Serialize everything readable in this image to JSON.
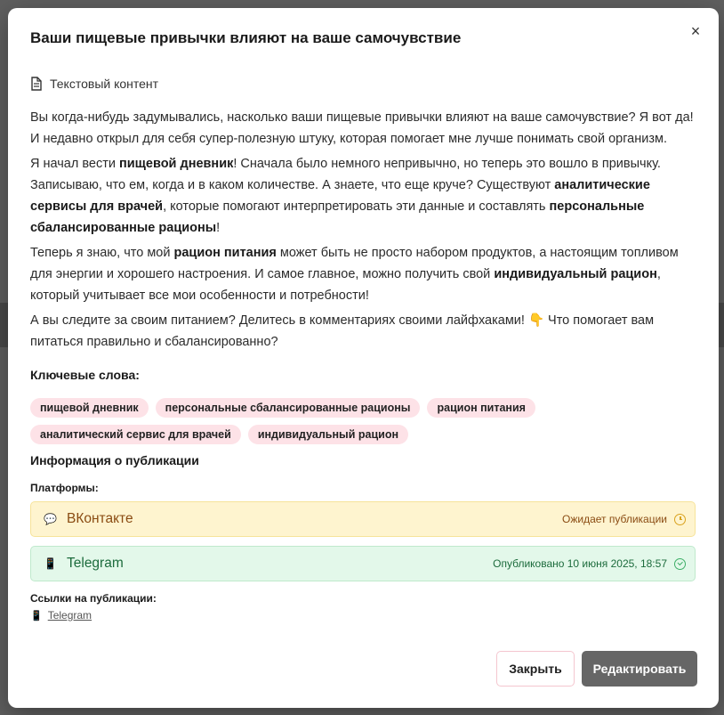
{
  "modal": {
    "title": "Ваши пищевые привычки влияют на ваше самочувствие",
    "content_type_label": "Текстовый контент",
    "paragraphs": [
      [
        {
          "text": "Вы когда-нибудь задумывались, насколько ваши пищевые привычки влияют на ваше самочувствие? Я вот да! И недавно открыл для себя супер-полезную штуку, которая помогает мне лучше понимать свой организм.",
          "bold": false
        }
      ],
      [
        {
          "text": "Я начал вести ",
          "bold": false
        },
        {
          "text": "пищевой дневник",
          "bold": true
        },
        {
          "text": "! Сначала было немного непривычно, но теперь это вошло в привычку. Записываю, что ем, когда и в каком количестве. А знаете, что еще круче? Существуют ",
          "bold": false
        },
        {
          "text": "аналитические сервисы для врачей",
          "bold": true
        },
        {
          "text": ", которые помогают интерпретировать эти данные и составлять ",
          "bold": false
        },
        {
          "text": "персональные сбалансированные рационы",
          "bold": true
        },
        {
          "text": "!",
          "bold": false
        }
      ],
      [
        {
          "text": "Теперь я знаю, что мой ",
          "bold": false
        },
        {
          "text": "рацион питания",
          "bold": true
        },
        {
          "text": " может быть не просто набором продуктов, а настоящим топливом для энергии и хорошего настроения. И самое главное, можно получить свой ",
          "bold": false
        },
        {
          "text": "индивидуальный рацион",
          "bold": true
        },
        {
          "text": ", который учитывает все мои особенности и потребности!",
          "bold": false
        }
      ],
      [
        {
          "text": "А вы следите за своим питанием? Делитесь в комментариях своими лайфхаками! 👇 Что помогает вам питаться правильно и сбалансированно?",
          "bold": false
        }
      ]
    ],
    "keywords_heading": "Ключевые слова:",
    "keywords_rows": [
      [
        "пищевой дневник",
        "персональные сбалансированные рационы",
        "рацион питания"
      ],
      [
        "аналитический сервис для врачей",
        "индивидуальный рацион"
      ]
    ],
    "publication_heading": "Информация о публикации",
    "platforms_label": "Платформы:",
    "platforms": [
      {
        "name": "ВКонтакте",
        "icon": "speech-bubble-icon",
        "status": "Ожидает публикации",
        "status_icon": "clock-icon",
        "color": "#fef4cf"
      },
      {
        "name": "Telegram",
        "icon": "phone-icon",
        "status": "Опубликовано 10 июня 2025, 18:57",
        "status_icon": "check-circle-icon",
        "color": "#e3f8ea"
      }
    ],
    "links_label": "Ссылки на публикации:",
    "links": [
      {
        "label": "Telegram",
        "icon": "phone-icon"
      }
    ],
    "buttons": {
      "close": "Закрыть",
      "edit": "Редактировать"
    },
    "close_icon": "×"
  }
}
